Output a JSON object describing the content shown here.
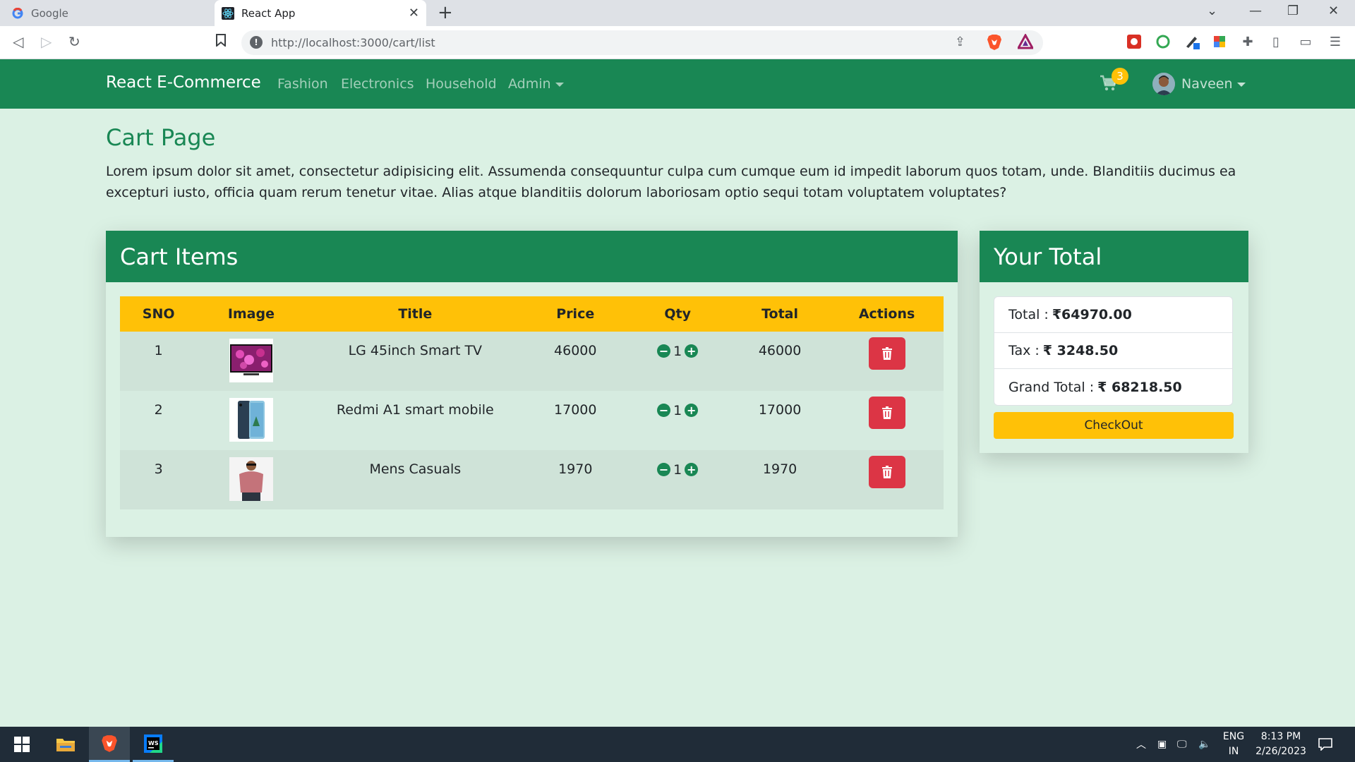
{
  "browser": {
    "tabs": [
      {
        "title": "Google"
      },
      {
        "title": "React App"
      }
    ],
    "url": "http://localhost:3000/cart/list"
  },
  "navbar": {
    "brand": "React E-Commerce",
    "links": [
      "Fashion",
      "Electronics",
      "Household",
      "Admin"
    ],
    "cart_count": "3",
    "user": "Naveen"
  },
  "page": {
    "title": "Cart Page",
    "description": "Lorem ipsum dolor sit amet, consectetur adipisicing elit. Assumenda consequuntur culpa cum cumque eum id impedit laborum quos totam, unde. Blanditiis ducimus ea excepturi iusto, officia quam rerum tenetur vitae. Alias atque blanditiis dolorum laboriosam optio sequi totam voluptatem voluptates?"
  },
  "cart": {
    "heading": "Cart Items",
    "columns": [
      "SNO",
      "Image",
      "Title",
      "Price",
      "Qty",
      "Total",
      "Actions"
    ],
    "rows": [
      {
        "sno": "1",
        "image": "tv-image",
        "title": "LG 45inch Smart TV",
        "price": "46000",
        "qty": "1",
        "total": "46000"
      },
      {
        "sno": "2",
        "image": "mobile-image",
        "title": "Redmi A1 smart mobile",
        "price": "17000",
        "qty": "1",
        "total": "17000"
      },
      {
        "sno": "3",
        "image": "shirt-image",
        "title": "Mens Casuals",
        "price": "1970",
        "qty": "1",
        "total": "1970"
      }
    ]
  },
  "summary": {
    "heading": "Your Total",
    "total_label": "Total :",
    "total_value": "₹64970.00",
    "tax_label": "Tax :",
    "tax_value": "₹ 3248.50",
    "grand_label": "Grand Total :",
    "grand_value": "₹ 68218.50",
    "checkout_label": "CheckOut"
  },
  "taskbar": {
    "lang_line1": "ENG",
    "lang_line2": "IN",
    "time": "8:13 PM",
    "date": "2/26/2023"
  },
  "colors": {
    "primary": "#198754",
    "warning": "#ffc107",
    "danger": "#dc3545",
    "page_bg": "#dbf1e4"
  }
}
